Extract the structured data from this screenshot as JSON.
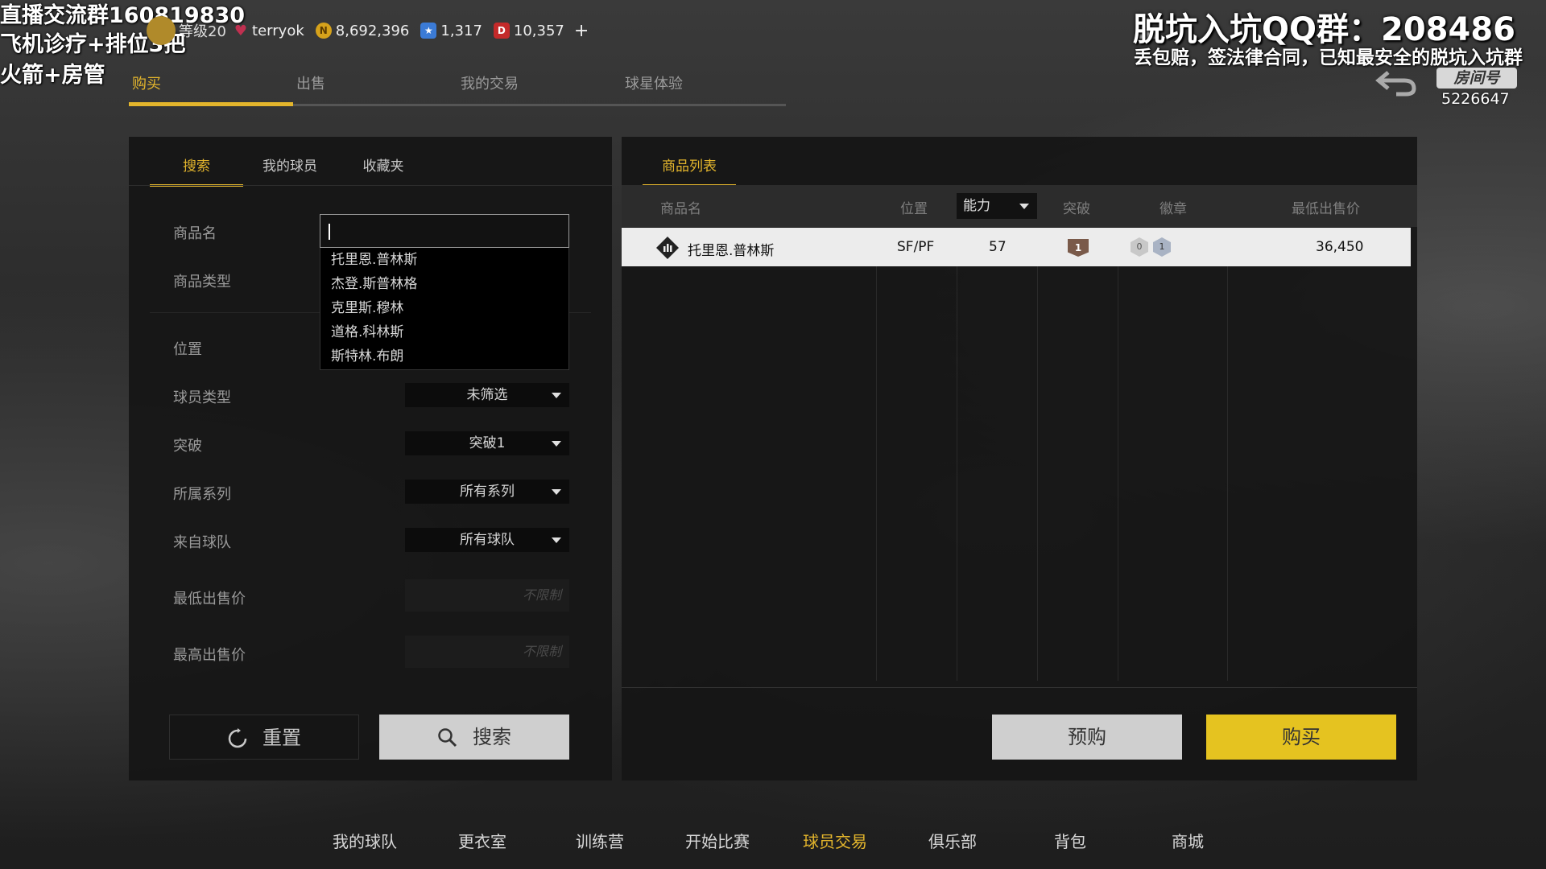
{
  "overlay": {
    "line1": "直播交流群160819830",
    "line2": "飞机诊疗+排位3把",
    "line3": "火箭+房管",
    "qq_group": "脱坑入坑QQ群：208486",
    "notice": "丢包赔，签法律合同，已知最安全的脱坑入坑群",
    "room_label": "房间号",
    "room_id": "5226647"
  },
  "header": {
    "level": "等级20",
    "username": "terryok",
    "coins": "8,692,396",
    "stars": "1,317",
    "tickets": "10,357",
    "add": "+"
  },
  "top_tabs": [
    {
      "label": "购买",
      "active": true
    },
    {
      "label": "出售",
      "active": false
    },
    {
      "label": "我的交易",
      "active": false
    },
    {
      "label": "球星体验",
      "active": false
    }
  ],
  "left_panel": {
    "tabs": [
      {
        "label": "搜索",
        "active": true
      },
      {
        "label": "我的球员",
        "active": false
      },
      {
        "label": "收藏夹",
        "active": false
      }
    ],
    "labels": {
      "item_name": "商品名",
      "item_type": "商品类型",
      "position": "位置",
      "player_type": "球员类型",
      "breakthrough": "突破",
      "series": "所属系列",
      "team": "来自球队",
      "min_price": "最低出售价",
      "max_price": "最高出售价"
    },
    "search_value": "",
    "suggestions": [
      "托里恩.普林斯",
      "杰登.斯普林格",
      "克里斯.穆林",
      "道格.科林斯",
      "斯特林.布朗"
    ],
    "selects": {
      "player_type": "未筛选",
      "breakthrough": "突破1",
      "series": "所有系列",
      "team": "所有球队"
    },
    "min_price_placeholder": "不限制",
    "max_price_placeholder": "不限制",
    "reset_label": "重置",
    "search_label": "搜索"
  },
  "right_panel": {
    "tab": "商品列表",
    "columns": {
      "name": "商品名",
      "position": "位置",
      "ability": "能力",
      "breakthrough": "突破",
      "badges": "徽章",
      "min_price": "最低出售价"
    },
    "rows": [
      {
        "name": "托里恩.普林斯",
        "position": "SF/PF",
        "ability": "57",
        "breakthrough": "1",
        "badge_a": "0",
        "badge_b": "1",
        "price": "36,450"
      }
    ],
    "prebuy_label": "预购",
    "buy_label": "购买"
  },
  "bottom_nav": [
    {
      "label": "我的球队",
      "active": false
    },
    {
      "label": "更衣室",
      "active": false
    },
    {
      "label": "训练营",
      "active": false
    },
    {
      "label": "开始比赛",
      "active": false
    },
    {
      "label": "球员交易",
      "active": true
    },
    {
      "label": "俱乐部",
      "active": false
    },
    {
      "label": "背包",
      "active": false
    },
    {
      "label": "商城",
      "active": false
    }
  ],
  "colors": {
    "accent": "#e3b52c",
    "buy_button": "#e5c320",
    "panel_bg": "#161616"
  }
}
